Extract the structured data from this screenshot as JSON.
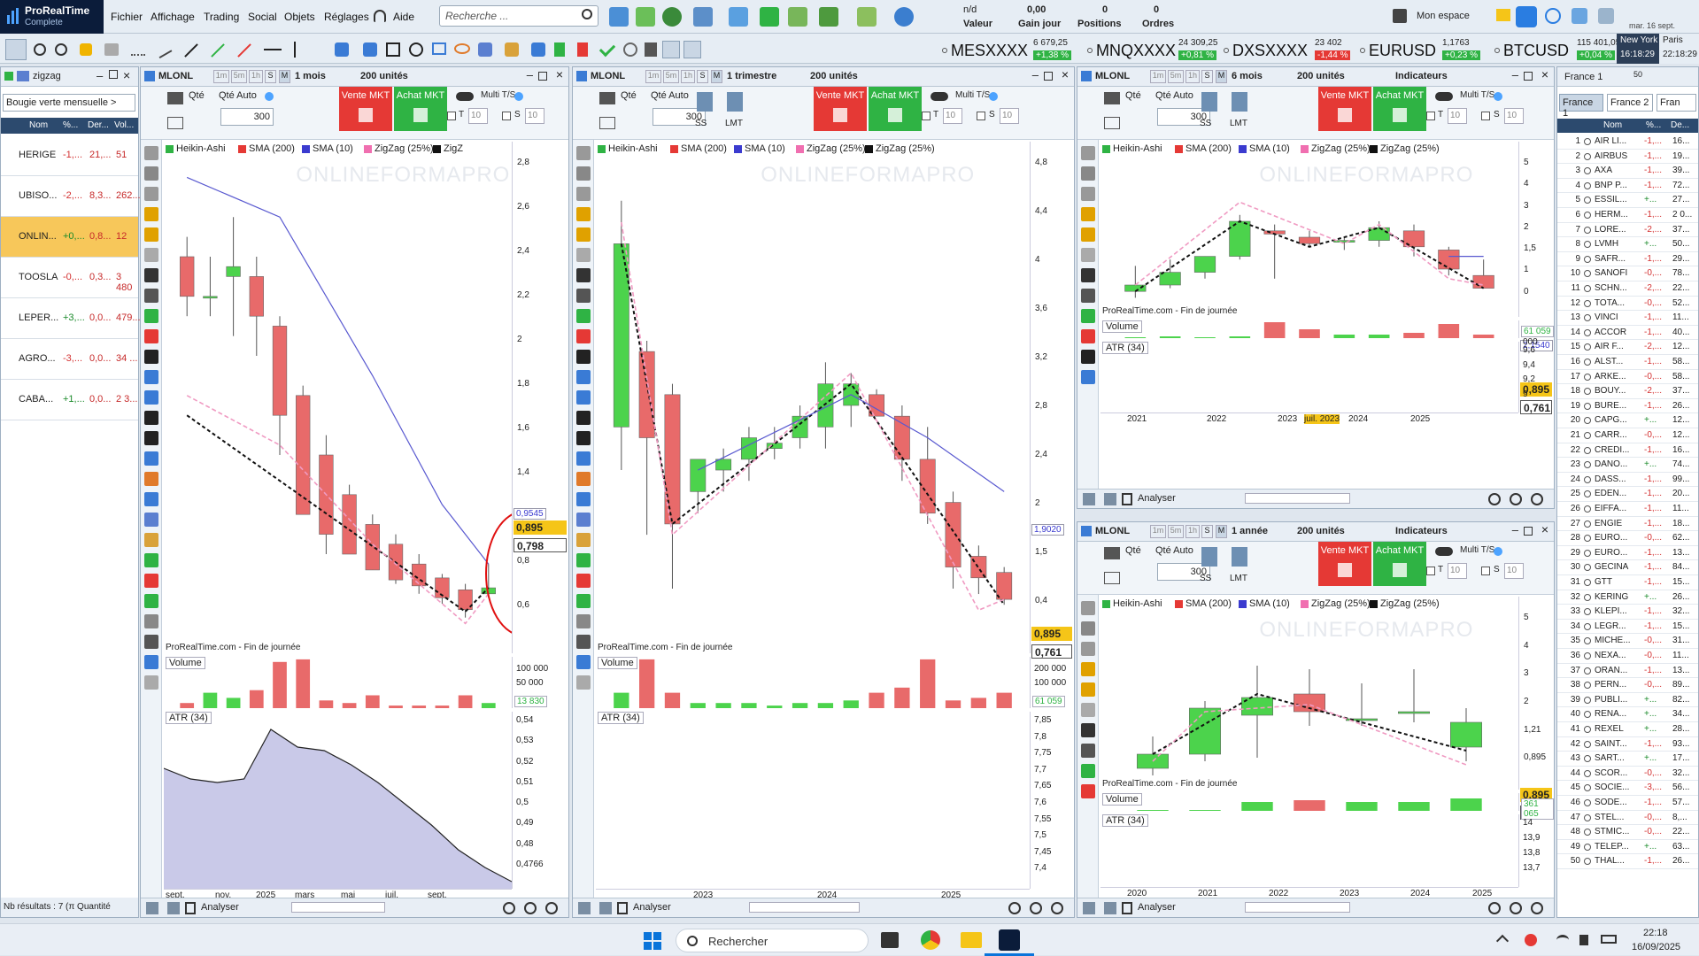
{
  "app": {
    "name": "ProRealTime",
    "edition": "Complete"
  },
  "menu": [
    "Fichier",
    "Affichage",
    "Trading",
    "Social",
    "Objets",
    "Réglages",
    "Aide"
  ],
  "search_placeholder": "Recherche ...",
  "account": {
    "nd": "n/d",
    "valeur": "Valeur",
    "gain": "0,00",
    "gain_label": "Gain jour",
    "positions": "0",
    "positions_label": "Positions",
    "ordres": "0",
    "ordres_label": "Ordres",
    "workspace": "Mon espace"
  },
  "clock": {
    "date": "mar. 16 sept.",
    "ny_label": "New York",
    "paris_label": "Paris",
    "ny_time": "16:18:29",
    "paris_time": "22:18:29",
    "vol": "Vol..."
  },
  "quotes": [
    {
      "name": "MESXXXX",
      "value": "6 679,25",
      "pct": "+1,38 %",
      "color": "#2fb344"
    },
    {
      "name": "MNQXXXX",
      "value": "24 309,25",
      "pct": "+0,81 %",
      "color": "#2fb344"
    },
    {
      "name": "DXSXXXX",
      "value": "23 402",
      "pct": "-1,44 %",
      "color": "#e53935"
    },
    {
      "name": "EURUSD",
      "value": "1,1763",
      "pct": "+0,23 %",
      "color": "#2fb344"
    },
    {
      "name": "BTCUSD",
      "value": "115 401,05",
      "pct": "+0,04 %",
      "color": "#2fb344"
    }
  ],
  "left_list": {
    "title": "zigzag",
    "filter": "Bougie verte mensuelle >",
    "cols": [
      "Nom",
      "%...",
      "Der...",
      "Vol..."
    ],
    "rows": [
      {
        "name": "HERIGE",
        "pct": "-1,...",
        "last": "21,...",
        "vol": "51"
      },
      {
        "name": "UBISO...",
        "pct": "-2,...",
        "last": "8,3...",
        "vol": "262..."
      },
      {
        "name": "ONLIN...",
        "pct": "+0,...",
        "last": "0,8...",
        "vol": "12"
      },
      {
        "name": "TOOSLA",
        "pct": "-0,...",
        "last": "0,3...",
        "vol": "3 480"
      },
      {
        "name": "LEPER...",
        "pct": "+3,...",
        "last": "0,0...",
        "vol": "479..."
      },
      {
        "name": "AGRO...",
        "pct": "-3,...",
        "last": "0,0...",
        "vol": "34 ..."
      },
      {
        "name": "CABA...",
        "pct": "+1,...",
        "last": "0,0...",
        "vol": "2 3..."
      }
    ],
    "footer": "Nb résultats : 7 (π Quantité"
  },
  "common": {
    "symbol": "MLONL",
    "qty_label": "Qté",
    "qty_auto": "Qté Auto",
    "qty": "300",
    "sell": "Vente MKT",
    "buy": "Achat MKT",
    "multi": "Multi T/S",
    "units": "200 unités",
    "indicators": "Indicateurs",
    "source": "ProRealTime.com - Fin de journée",
    "volume": "Volume",
    "atr": "ATR (34)",
    "analyser": "Analyser",
    "watermark": "ONLINEFORMAPRO",
    "ss": "SS",
    "lmt": "LMT",
    "t": "T",
    "s": "S",
    "pct10": "10"
  },
  "legend": {
    "ha": "Heikin-Ashi",
    "sma200": "SMA (200)",
    "sma10": "SMA (10)",
    "zz": "ZigZag (25%)",
    "zz2": "ZigZag (25%)",
    "zzshort": "ZigZ"
  },
  "panel1": {
    "period": "1 mois",
    "yticks": [
      "2,8",
      "2,6",
      "2,4",
      "2,2",
      "2",
      "1,8",
      "1,6",
      "1,4",
      "1,2",
      "0,8",
      "0,6"
    ],
    "xticks": [
      "sept.",
      "nov.",
      "2025",
      "mars",
      "mai",
      "juil.",
      "sept."
    ],
    "price": "0,895",
    "price2": "0,798",
    "p3": "0,9545",
    "p4": "0,7976",
    "volticks": [
      "100 000",
      "50 000"
    ],
    "vol_last": "13 830",
    "atrticks": [
      "0,54",
      "0,53",
      "0,52",
      "0,51",
      "0,5",
      "0,49",
      "0,48",
      "0,4766"
    ]
  },
  "panel2": {
    "period": "1 trimestre",
    "yticks": [
      "4,8",
      "4,4",
      "4",
      "3,6",
      "3,2",
      "2,8",
      "2,4",
      "2",
      "1,5",
      "0,4"
    ],
    "xticks": [
      "2023",
      "2024",
      "2025"
    ],
    "price": "0,895",
    "price2": "0,761",
    "p3": "1,9020",
    "volticks": [
      "200 000",
      "100 000"
    ],
    "vol_last": "61 059",
    "atrticks": [
      "7,85",
      "7,8",
      "7,75",
      "7,7",
      "7,65",
      "7,6",
      "7,55",
      "7,5",
      "7,45",
      "7,4"
    ]
  },
  "panel3": {
    "period": "6 mois",
    "yticks": [
      "5",
      "4",
      "3",
      "2",
      "1,5",
      "1",
      "0"
    ],
    "xticks": [
      "2021",
      "2022",
      "2023",
      "juil. 2023",
      "2024",
      "2025"
    ],
    "price": "0,895",
    "price2": "0,761",
    "p3": "2,1540",
    "volticks": [
      "200 000"
    ],
    "vol_last": "61 059",
    "atrticks": [
      "9,6",
      "9,4",
      "9,2",
      "9"
    ]
  },
  "panel4": {
    "period": "1 année",
    "yticks": [
      "5",
      "4",
      "3",
      "2",
      "1,21",
      "0,895"
    ],
    "xticks": [
      "2020",
      "2021",
      "2022",
      "2023",
      "2024",
      "2025"
    ],
    "price": "0,895",
    "price2": "1,21",
    "vol_last": "361 065",
    "atrticks": [
      "14",
      "13,9",
      "13,8",
      "13,7"
    ]
  },
  "right_list": {
    "title": "France 1",
    "tabs": [
      "France 1",
      "France 2",
      "Fran"
    ],
    "cols": [
      "Nom",
      "%...",
      "De..."
    ],
    "rows": [
      [
        "1",
        "AIR LI...",
        "-1,...",
        "16..."
      ],
      [
        "2",
        "AIRBUS",
        "-1,...",
        "19..."
      ],
      [
        "3",
        "AXA",
        "-1,...",
        "39..."
      ],
      [
        "4",
        "BNP P...",
        "-1,...",
        "72..."
      ],
      [
        "5",
        "ESSIL...",
        "+...",
        "27..."
      ],
      [
        "6",
        "HERM...",
        "-1,...",
        "2 0..."
      ],
      [
        "7",
        "LORE...",
        "-2,...",
        "37..."
      ],
      [
        "8",
        "LVMH",
        "+...",
        "50..."
      ],
      [
        "9",
        "SAFR...",
        "-1,...",
        "29..."
      ],
      [
        "10",
        "SANOFI",
        "-0,...",
        "78..."
      ],
      [
        "11",
        "SCHN...",
        "-2,...",
        "22..."
      ],
      [
        "12",
        "TOTA...",
        "-0,...",
        "52..."
      ],
      [
        "13",
        "VINCI",
        "-1,...",
        "11..."
      ],
      [
        "14",
        "ACCOR",
        "-1,...",
        "40..."
      ],
      [
        "15",
        "AIR F...",
        "-2,...",
        "12..."
      ],
      [
        "16",
        "ALST...",
        "-1,...",
        "58..."
      ],
      [
        "17",
        "ARKE...",
        "-0,...",
        "58..."
      ],
      [
        "18",
        "BOUY...",
        "-2,...",
        "37..."
      ],
      [
        "19",
        "BURE...",
        "-1,...",
        "26..."
      ],
      [
        "20",
        "CAPG...",
        "+...",
        "12..."
      ],
      [
        "21",
        "CARR...",
        "-0,...",
        "12..."
      ],
      [
        "22",
        "CREDI...",
        "-1,...",
        "16..."
      ],
      [
        "23",
        "DANO...",
        "+...",
        "74..."
      ],
      [
        "24",
        "DASS...",
        "-1,...",
        "99..."
      ],
      [
        "25",
        "EDEN...",
        "-1,...",
        "20..."
      ],
      [
        "26",
        "EIFFA...",
        "-1,...",
        "11..."
      ],
      [
        "27",
        "ENGIE",
        "-1,...",
        "18..."
      ],
      [
        "28",
        "EURO...",
        "-0,...",
        "62..."
      ],
      [
        "29",
        "EURO...",
        "-1,...",
        "13..."
      ],
      [
        "30",
        "GECINA",
        "-1,...",
        "84..."
      ],
      [
        "31",
        "GTT",
        "-1,...",
        "15..."
      ],
      [
        "32",
        "KERING",
        "+...",
        "26..."
      ],
      [
        "33",
        "KLEPI...",
        "-1,...",
        "32..."
      ],
      [
        "34",
        "LEGR...",
        "-1,...",
        "15..."
      ],
      [
        "35",
        "MICHE...",
        "-0,...",
        "31..."
      ],
      [
        "36",
        "NEXA...",
        "-0,...",
        "11..."
      ],
      [
        "37",
        "ORAN...",
        "-1,...",
        "13..."
      ],
      [
        "38",
        "PERN...",
        "-0,...",
        "89..."
      ],
      [
        "39",
        "PUBLI...",
        "+...",
        "82..."
      ],
      [
        "40",
        "RENA...",
        "+...",
        "34..."
      ],
      [
        "41",
        "REXEL",
        "+...",
        "28..."
      ],
      [
        "42",
        "SAINT...",
        "-1,...",
        "93..."
      ],
      [
        "43",
        "SART...",
        "+...",
        "17..."
      ],
      [
        "44",
        "SCOR...",
        "-0,...",
        "32..."
      ],
      [
        "45",
        "SOCIE...",
        "-3,...",
        "56..."
      ],
      [
        "46",
        "SODE...",
        "-1,...",
        "57..."
      ],
      [
        "47",
        "STEL...",
        "-0,...",
        "8,..."
      ],
      [
        "48",
        "STMIC...",
        "-0,...",
        "22..."
      ],
      [
        "49",
        "TELEP...",
        "+...",
        "63..."
      ],
      [
        "50",
        "THAL...",
        "-1,...",
        "26..."
      ]
    ]
  },
  "taskbar": {
    "search": "Rechercher",
    "time": "22:18",
    "date": "16/09/2025"
  }
}
